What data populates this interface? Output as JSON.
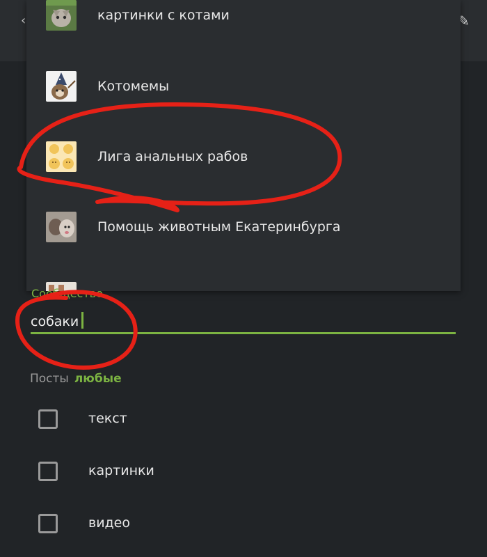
{
  "dropdown": {
    "items": [
      {
        "label": "картинки с котами",
        "thumb": "cat-photo-icon"
      },
      {
        "label": "Котомемы",
        "thumb": "cat-wizard-icon"
      },
      {
        "label": "Лига анальных рабов",
        "thumb": "emoji-faces-icon"
      },
      {
        "label": "Помощь животным Екатеринбурга",
        "thumb": "kittens-photo-icon"
      }
    ]
  },
  "community_field": {
    "label": "Сообщество",
    "value": "собаки"
  },
  "posts": {
    "label": "Посты",
    "value": "любые"
  },
  "checkboxes": [
    {
      "label": "текст",
      "checked": false
    },
    {
      "label": "картинки",
      "checked": false
    },
    {
      "label": "видео",
      "checked": false
    }
  ],
  "colors": {
    "accent": "#7cb342",
    "background": "#212427",
    "annotation": "#e62117"
  }
}
